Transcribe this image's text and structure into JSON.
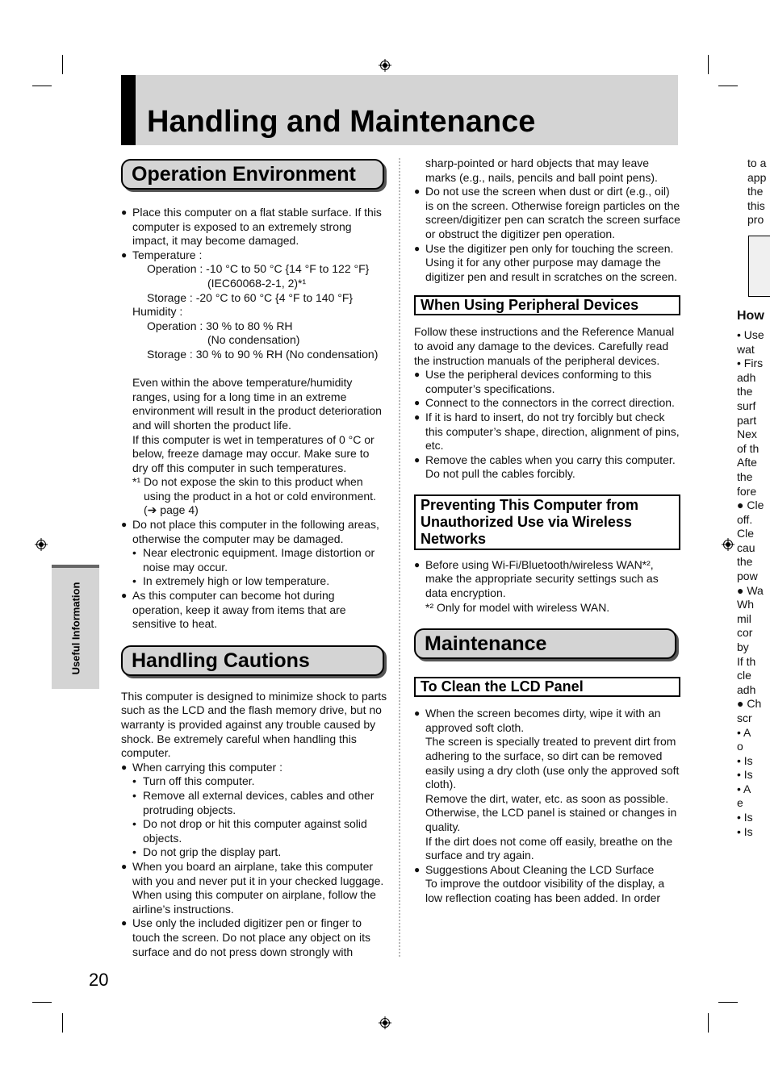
{
  "page": {
    "title": "Handling and Maintenance",
    "page_number": "20",
    "side_tab": "Useful Information"
  },
  "operation_environment": {
    "heading": "Operation Environment",
    "bullet_surface": "Place this computer on a flat stable surface. If this computer is exposed to an extremely strong impact, it may become damaged.",
    "temperature_label": "Temperature :",
    "temp_operation": "Operation : -10 °C to 50 °C {14 °F to 122 °F}",
    "temp_operation_std": "(IEC60068-2-1, 2)*¹",
    "temp_storage": "Storage : -20 °C to 60 °C {4 °F to 140 °F}",
    "humidity_label": "Humidity :",
    "hum_operation": "Operation : 30 % to 80 % RH",
    "hum_operation_note": "(No condensation)",
    "hum_storage": "Storage : 30 % to 90 % RH (No condensation)",
    "para_extreme": "Even within the above temperature/humidity ranges, using for a long time in an extreme environment will result in the product deterioration and will shorten the product life.",
    "para_wet": "If this computer is wet in temperatures of 0 °C or below, freeze damage may occur. Make sure to dry off this computer in such temperatures.",
    "footnote_1": "*¹ Do not expose the skin to this product when using the product in a hot or cold environment. (➔ page 4)",
    "bullet_areas": "Do not place this computer in the following areas, otherwise the computer may be damaged.",
    "sub_areas": [
      "Near electronic equipment. Image distortion or noise may occur.",
      "In extremely high or low temperature."
    ],
    "bullet_hot": "As this computer can become hot during operation, keep it away from items that are sensitive to heat."
  },
  "handling_cautions": {
    "heading": "Handling Cautions",
    "intro": "This computer is designed to minimize shock to parts such as the LCD and the flash memory drive, but no warranty is provided against any trouble caused by shock. Be extremely careful when handling this computer.",
    "bullet_carry": "When carrying this computer :",
    "sub_carry": [
      "Turn off this computer.",
      "Remove all external devices, cables and other protruding objects.",
      "Do not drop or hit this computer against solid objects.",
      "Do not grip the display part."
    ],
    "bullet_airplane": "When you board an airplane, take this computer with you and never put it in your checked luggage. When using this computer on airplane, follow the airline’s instructions.",
    "bullet_pen": "Use only the included digitizer pen or finger to touch the screen. Do not place any object on its surface and do not press down strongly with",
    "pen_continued": "sharp-pointed or hard objects that may leave marks (e.g., nails, pencils and ball point pens).",
    "bullet_dust": "Do not use the screen when dust or dirt (e.g., oil) is on the screen. Otherwise foreign particles on the screen/digitizer pen can scratch the screen surface or obstruct the digitizer pen operation.",
    "bullet_pen_only": "Use the digitizer pen only for touching the screen. Using it for any other purpose may damage the digitizer pen and result in scratches on the screen."
  },
  "peripheral_devices": {
    "heading": "When Using Peripheral Devices",
    "intro": "Follow these instructions and the Reference Manual to avoid any damage to the devices. Carefully read the instruction manuals of the peripheral devices.",
    "bullets": [
      "Use the peripheral devices conforming to this computer’s specifications.",
      "Connect to the connectors in the correct direction.",
      "If it is hard to insert, do not try forcibly but check this computer’s shape, direction, alignment of pins, etc.",
      "Remove the cables when you carry this computer. Do not pull the cables forcibly."
    ]
  },
  "wireless": {
    "heading": "Preventing This Computer from Unauthorized Use via Wireless Networks",
    "bullet": "Before using Wi-Fi/Bluetooth/wireless WAN*², make the appropriate security settings such as data encryption.",
    "footnote_2": "*² Only for model with wireless WAN."
  },
  "maintenance": {
    "heading": "Maintenance",
    "lcd_heading": "To Clean the LCD Panel",
    "bullet_dirty": "When the screen becomes dirty, wipe it with an approved soft cloth.",
    "para_treated": "The screen is specially treated to prevent dirt from adhering to the surface, so dirt can be removed easily using a dry cloth (use only the approved soft cloth).",
    "para_remove": "Remove the dirt, water, etc. as soon as possible. Otherwise, the LCD panel is stained or changes in quality.",
    "para_breathe": "If the dirt does not come off easily, breathe on the surface and try again.",
    "bullet_suggestions": "Suggestions About Cleaning the LCD Surface",
    "para_outdoor": "To improve the outdoor visibility of the display, a low reflection coating has been added. In order"
  },
  "next_page_fragment": {
    "lines_top": [
      "to a",
      "app",
      "the",
      "this",
      "pro"
    ],
    "heading": "How",
    "lines_mid": [
      "• Use",
      "wat",
      "• Firs",
      "adh",
      "the",
      "surf",
      "part",
      "Nex",
      "of th",
      "Afte",
      "the",
      "fore"
    ],
    "lines_bottom": [
      "● Cle",
      "off.",
      "Cle",
      "cau",
      "the",
      "pow",
      "● Wa",
      "Wh",
      "mil",
      "cor",
      "by",
      "If th",
      "cle",
      "adh",
      "● Ch",
      "scr",
      "• A",
      "o",
      "• Is",
      "• Is",
      "• A",
      "e",
      "• Is",
      "• Is"
    ]
  }
}
